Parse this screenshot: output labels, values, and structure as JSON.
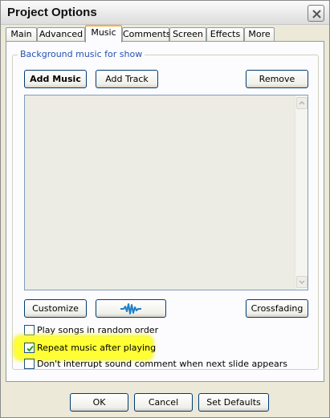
{
  "window": {
    "title": "Project Options"
  },
  "tabs": [
    {
      "label": "Main"
    },
    {
      "label": "Advanced"
    },
    {
      "label": "Music",
      "active": true
    },
    {
      "label": "Comments"
    },
    {
      "label": "Screen"
    },
    {
      "label": "Effects"
    },
    {
      "label": "More"
    }
  ],
  "group": {
    "label": "Background music for show"
  },
  "toolbar": {
    "add_music": "Add Music",
    "add_track": "Add Track",
    "remove": "Remove"
  },
  "list": {
    "items": []
  },
  "bottom_bar": {
    "customize": "Customize",
    "waveform_icon": "waveform-icon",
    "crossfading": "Crossfading"
  },
  "options": {
    "random_order": {
      "label": "Play songs in random order",
      "checked": false
    },
    "repeat": {
      "label": "Repeat music after playing",
      "checked": true,
      "highlight_color": "#ffff33"
    },
    "no_interrupt": {
      "label": "Don't interrupt sound comment when next slide appears",
      "checked": false
    }
  },
  "footer": {
    "ok": "OK",
    "cancel": "Cancel",
    "set_defaults": "Set Defaults"
  },
  "colors": {
    "group_label": "#2452b0",
    "active_tab_accent": "#f5b335",
    "waveform": "#1e7fc6"
  }
}
